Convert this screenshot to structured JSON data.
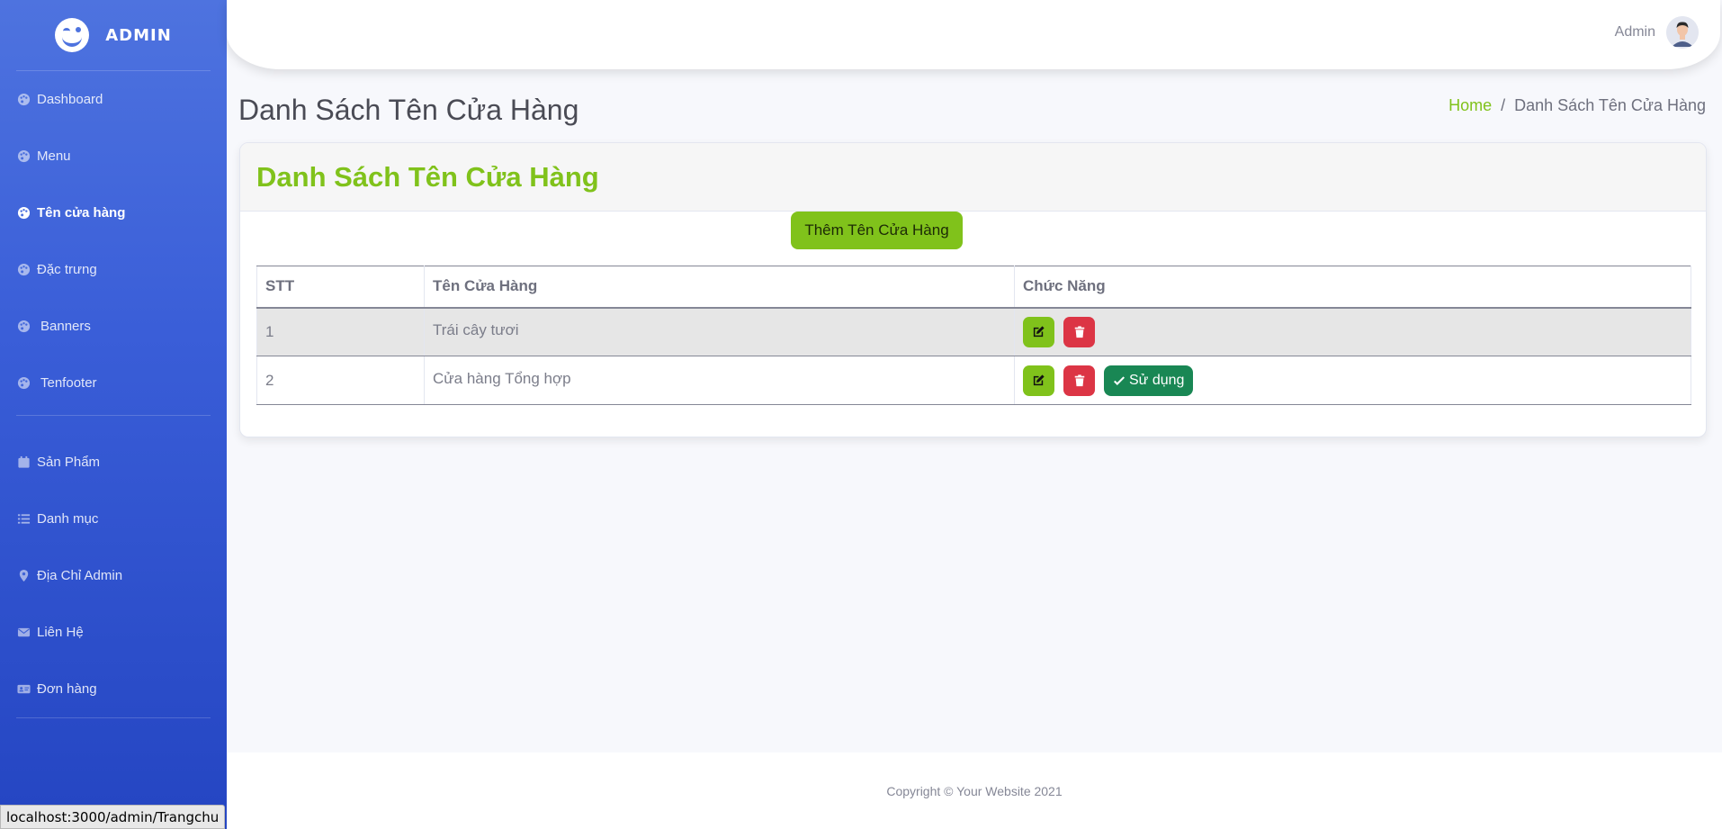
{
  "sidebar": {
    "brand": "ADMIN",
    "group1": [
      {
        "label": "Dashboard",
        "icon": "palette-icon"
      },
      {
        "label": "Menu",
        "icon": "palette-icon"
      },
      {
        "label": "Tên cửa hàng",
        "icon": "palette-icon"
      },
      {
        "label": "Đặc trưng",
        "icon": "palette-icon"
      },
      {
        "label": "Banners",
        "icon": "palette-icon"
      },
      {
        "label": "Tenfooter",
        "icon": "palette-icon"
      }
    ],
    "group2": [
      {
        "label": "Sản Phẩm",
        "icon": "calendar-icon"
      },
      {
        "label": "Danh mục",
        "icon": "list-icon"
      },
      {
        "label": "Địa Chỉ Admin",
        "icon": "map-pin-icon"
      },
      {
        "label": "Liên Hệ",
        "icon": "envelope-icon"
      },
      {
        "label": "Đơn hàng",
        "icon": "id-card-icon"
      }
    ]
  },
  "topbar": {
    "user_name": "Admin"
  },
  "page": {
    "title": "Danh Sách Tên Cửa Hàng",
    "breadcrumb": {
      "home": "Home",
      "separator": "/",
      "current": "Danh Sách Tên Cửa Hàng"
    }
  },
  "card": {
    "title": "Danh Sách Tên Cửa Hàng",
    "add_button": "Thêm Tên Cửa Hàng",
    "table": {
      "headers": [
        "STT",
        "Tên Cửa Hàng",
        "Chức Năng"
      ],
      "rows": [
        {
          "stt": "1",
          "name": "Trái cây tươi",
          "in_use": false
        },
        {
          "stt": "2",
          "name": "Cửa hàng Tổng hợp",
          "in_use": true,
          "use_label": "Sử dụng"
        }
      ]
    }
  },
  "footer": {
    "copyright": "Copyright © Your Website 2021"
  },
  "status_bar": {
    "url": "localhost:3000/admin/Trangchu"
  },
  "colors": {
    "accent": "#80c21b",
    "sidebar": "#4e73df",
    "danger": "#dc3545",
    "success": "#198754"
  }
}
